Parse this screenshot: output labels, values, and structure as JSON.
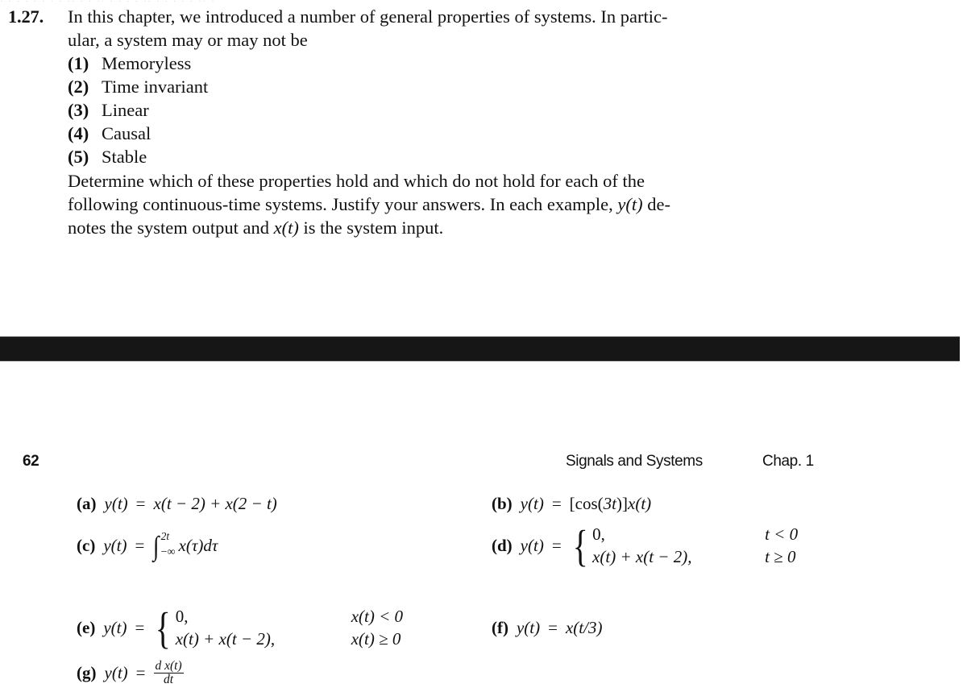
{
  "page": {
    "background_color": "#ffffff",
    "text_color": "#111111",
    "top_sliver_artifact": "· · · ·   · ·  ·   ·   ·· ·  ·  ·· · ·   ·  ·   ·· ·  ·   ·  ·  · ·· ·"
  },
  "problem": {
    "number": "1.27.",
    "intro_line_1": "In this chapter, we introduced a number of general properties of systems. In partic-",
    "intro_line_2": "ular, a system may or may not be",
    "properties": [
      {
        "marker": "(1)",
        "label": "Memoryless"
      },
      {
        "marker": "(2)",
        "label": "Time invariant"
      },
      {
        "marker": "(3)",
        "label": "Linear"
      },
      {
        "marker": "(4)",
        "label": "Causal"
      },
      {
        "marker": "(5)",
        "label": "Stable"
      }
    ],
    "determine_line_1": "Determine which of these properties hold and which do not hold for each of the",
    "determine_line_2_a": "following continuous-time systems. Justify your answers. In each example, ",
    "determine_line_2_var": "y(t)",
    "determine_line_2_b": " de-",
    "determine_line_3_a": "notes the system output and ",
    "determine_line_3_var": "x(t)",
    "determine_line_3_b": " is the system input."
  },
  "scan_band": {
    "color": "#1a1a1a",
    "edge_color": "#b9b9b9"
  },
  "running_head": {
    "page_number": "62",
    "title": "Signals and Systems",
    "chapter": "Chap. 1"
  },
  "equations": {
    "a": {
      "tag": "(a)",
      "lhs": "y(t)",
      "eq": "=",
      "rhs": "x(t − 2) + x(2 − t)"
    },
    "b": {
      "tag": "(b)",
      "lhs": "y(t)",
      "eq": "=",
      "rhs_bracket_open": "[",
      "rhs_cos": "cos(3t)",
      "rhs_bracket_close": "]",
      "rhs_tail": "x(t)"
    },
    "c": {
      "tag": "(c)",
      "lhs": "y(t)",
      "eq": "=",
      "integral_sign": "∫",
      "upper_limit": "2t",
      "lower_limit": "−∞",
      "integrand": "x(τ)dτ"
    },
    "d": {
      "tag": "(d)",
      "lhs": "y(t)",
      "eq": "=",
      "cases": [
        {
          "value": "0,",
          "condition": "t < 0"
        },
        {
          "value": "x(t) + x(t − 2),",
          "condition": "t ≥ 0"
        }
      ]
    },
    "e": {
      "tag": "(e)",
      "lhs": "y(t)",
      "eq": "=",
      "cases": [
        {
          "value": "0,",
          "condition": "x(t) < 0"
        },
        {
          "value": "x(t) + x(t − 2),",
          "condition": "x(t) ≥ 0"
        }
      ]
    },
    "f": {
      "tag": "(f)",
      "lhs": "y(t)",
      "eq": "=",
      "rhs": "x(t/3)"
    },
    "g": {
      "tag": "(g)",
      "lhs": "y(t)",
      "eq": "=",
      "frac_numerator": "d x(t)",
      "frac_denominator": "dt"
    }
  }
}
